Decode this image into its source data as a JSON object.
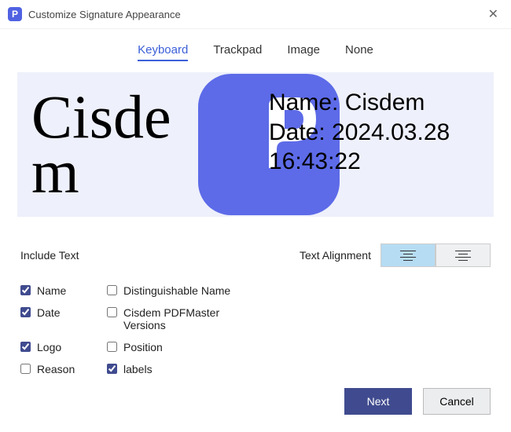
{
  "window": {
    "title": "Customize Signature Appearance",
    "app_icon_letter": "P"
  },
  "tabs": {
    "keyboard": "Keyboard",
    "trackpad": "Trackpad",
    "image": "Image",
    "none": "None",
    "active": "keyboard"
  },
  "preview": {
    "left_text": "Cisdem",
    "name_line": "Name: Cisdem",
    "date_line": "Date: 2024.03.28",
    "time_line": "16:43:22"
  },
  "include": {
    "section_label": "Include Text",
    "alignment_label": "Text Alignment",
    "options": {
      "name": {
        "label": "Name",
        "checked": true
      },
      "dist_name": {
        "label": "Distinguishable Name",
        "checked": false
      },
      "date": {
        "label": "Date",
        "checked": true
      },
      "versions": {
        "label": "Cisdem PDFMaster Versions",
        "checked": false
      },
      "logo": {
        "label": "Logo",
        "checked": true
      },
      "position": {
        "label": "Position",
        "checked": false
      },
      "reason": {
        "label": "Reason",
        "checked": false
      },
      "labels": {
        "label": "labels",
        "checked": true
      }
    }
  },
  "footer": {
    "next": "Next",
    "cancel": "Cancel"
  }
}
